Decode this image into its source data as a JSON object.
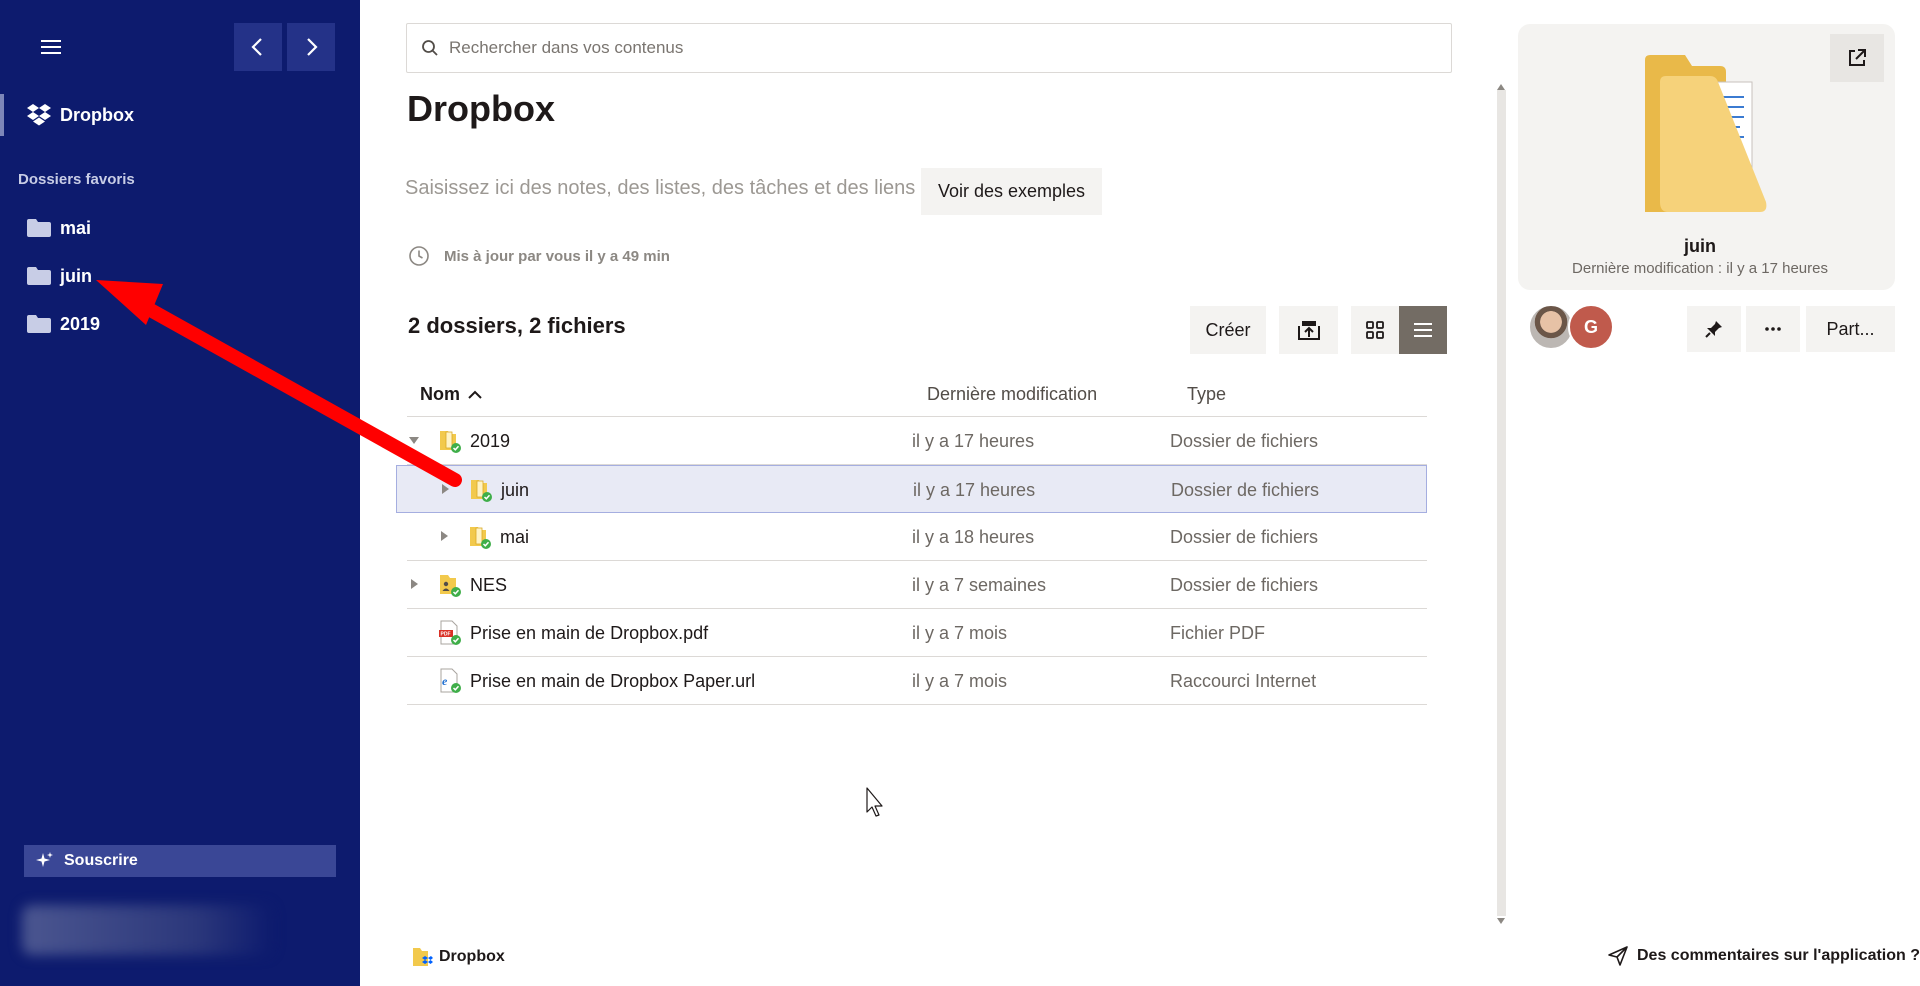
{
  "sidebar": {
    "home_label": "Dropbox",
    "section_label": "Dossiers favoris",
    "favorites": [
      {
        "label": "mai"
      },
      {
        "label": "juin"
      },
      {
        "label": "2019"
      }
    ],
    "subscribe_label": "Souscrire"
  },
  "search": {
    "placeholder": "Rechercher dans vos contenus"
  },
  "page": {
    "title": "Dropbox",
    "notes_placeholder": "Saisissez ici des notes, des listes, des tâches et des liens",
    "examples_button": "Voir des exemples",
    "updated_text": "Mis à jour par vous il y a 49 min",
    "count_title": "2 dossiers, 2 fichiers",
    "create_button": "Créer"
  },
  "table": {
    "headers": {
      "name": "Nom",
      "modified": "Dernière modification",
      "type": "Type"
    },
    "rows": [
      {
        "name": "2019",
        "modified": "il y a 17 heures",
        "type": "Dossier de fichiers",
        "level": 0,
        "expanded": true,
        "kind": "folder"
      },
      {
        "name": "juin",
        "modified": "il y a 17 heures",
        "type": "Dossier de fichiers",
        "level": 1,
        "expanded": false,
        "kind": "folder",
        "selected": true
      },
      {
        "name": "mai",
        "modified": "il y a 18 heures",
        "type": "Dossier de fichiers",
        "level": 1,
        "expanded": false,
        "kind": "folder"
      },
      {
        "name": "NES",
        "modified": "il y a 7 semaines",
        "type": "Dossier de fichiers",
        "level": 0,
        "expanded": false,
        "kind": "shared-folder"
      },
      {
        "name": "Prise en main de Dropbox.pdf",
        "modified": "il y a 7 mois",
        "type": "Fichier PDF",
        "level": 0,
        "kind": "pdf"
      },
      {
        "name": "Prise en main de Dropbox Paper.url",
        "modified": "il y a 7 mois",
        "type": "Raccourci Internet",
        "level": 0,
        "kind": "url"
      }
    ]
  },
  "footer": {
    "breadcrumb": "Dropbox",
    "feedback": "Des commentaires sur l'application ?"
  },
  "details": {
    "name": "juin",
    "modified": "Dernière modification : il y a 17 heures",
    "avatar_initial": "G",
    "share_label": "Part..."
  },
  "colors": {
    "sidebar_bg": "#0d1b6e",
    "selected_row": "#e8eaf5",
    "annotation_arrow": "#ff0000"
  }
}
